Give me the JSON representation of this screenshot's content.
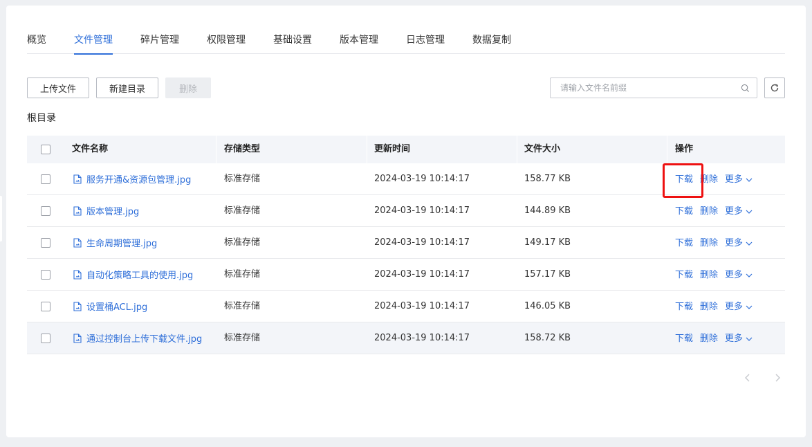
{
  "tabs": [
    "概览",
    "文件管理",
    "碎片管理",
    "权限管理",
    "基础设置",
    "版本管理",
    "日志管理",
    "数据复制"
  ],
  "active_tab": "文件管理",
  "toolbar": {
    "upload_label": "上传文件",
    "new_dir_label": "新建目录",
    "delete_label": "删除"
  },
  "search": {
    "placeholder": "请输入文件名前缀"
  },
  "breadcrumb": "根目录",
  "table": {
    "headers": {
      "name": "文件名称",
      "storage": "存储类型",
      "updated": "更新时间",
      "size": "文件大小",
      "ops": "操作"
    },
    "rows": [
      {
        "name": "服务开通&资源包管理.jpg",
        "storage": "标准存储",
        "updated": "2024-03-19 10:14:17",
        "size": "158.77 KB"
      },
      {
        "name": "版本管理.jpg",
        "storage": "标准存储",
        "updated": "2024-03-19 10:14:17",
        "size": "144.89 KB"
      },
      {
        "name": "生命周期管理.jpg",
        "storage": "标准存储",
        "updated": "2024-03-19 10:14:17",
        "size": "149.17 KB"
      },
      {
        "name": "自动化策略工具的使用.jpg",
        "storage": "标准存储",
        "updated": "2024-03-19 10:14:17",
        "size": "157.17 KB"
      },
      {
        "name": "设置桶ACL.jpg",
        "storage": "标准存储",
        "updated": "2024-03-19 10:14:17",
        "size": "146.05 KB"
      },
      {
        "name": "通过控制台上传下载文件.jpg",
        "storage": "标准存储",
        "updated": "2024-03-19 10:14:17",
        "size": "158.72 KB"
      }
    ],
    "actions": {
      "download": "下载",
      "delete": "删除",
      "more": "更多"
    }
  },
  "colors": {
    "accent": "#2f6fd9",
    "highlight": "#ee1111"
  }
}
